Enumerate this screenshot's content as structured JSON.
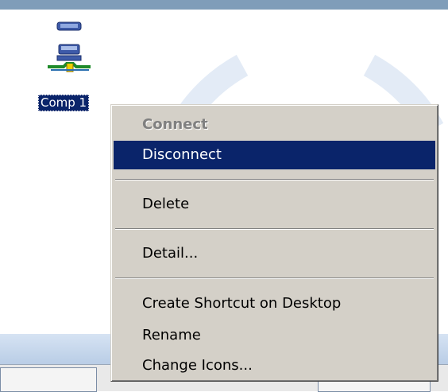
{
  "desktop": {
    "icon_name": "network-computer-icon",
    "icon_label": "Comp 1"
  },
  "context_menu": {
    "items": [
      {
        "label": "Connect",
        "state": "disabled"
      },
      {
        "label": "Disconnect",
        "state": "highlighted"
      },
      {
        "label": "Delete",
        "state": "normal"
      },
      {
        "label": "Detail...",
        "state": "normal"
      },
      {
        "label": "Create Shortcut on Desktop",
        "state": "normal"
      },
      {
        "label": "Rename",
        "state": "normal"
      },
      {
        "label": "Change Icons...",
        "state": "normal"
      }
    ]
  },
  "colors": {
    "selection": "#0a246a",
    "menu_face": "#d4d0c8",
    "disabled_text": "#808080",
    "watermark": "#e3ebf6"
  }
}
